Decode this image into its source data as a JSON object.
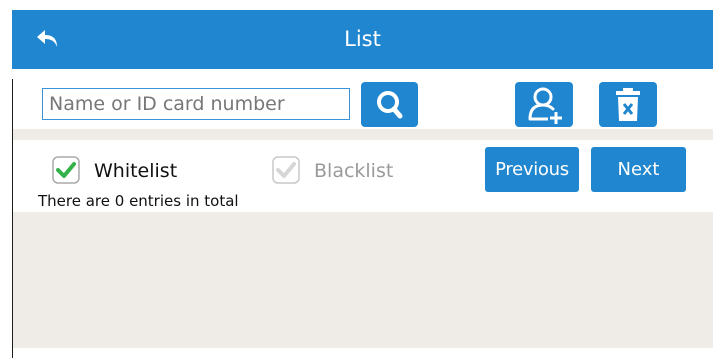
{
  "header": {
    "title": "List"
  },
  "search": {
    "placeholder": "Name or ID card number",
    "value": ""
  },
  "filters": {
    "whitelist_label": "Whitelist",
    "whitelist_checked": true,
    "blacklist_label": "Blacklist",
    "blacklist_checked": false
  },
  "pagination": {
    "previous_label": "Previous",
    "next_label": "Next"
  },
  "summary": {
    "total_text": "There are 0 entries in total"
  },
  "colors": {
    "accent": "#1f86cf",
    "check_green": "#34b24a",
    "background": "#efece8"
  },
  "icons": {
    "back": "back-arrow-icon",
    "search": "search-icon",
    "add_user": "add-user-icon",
    "delete": "trash-icon"
  }
}
